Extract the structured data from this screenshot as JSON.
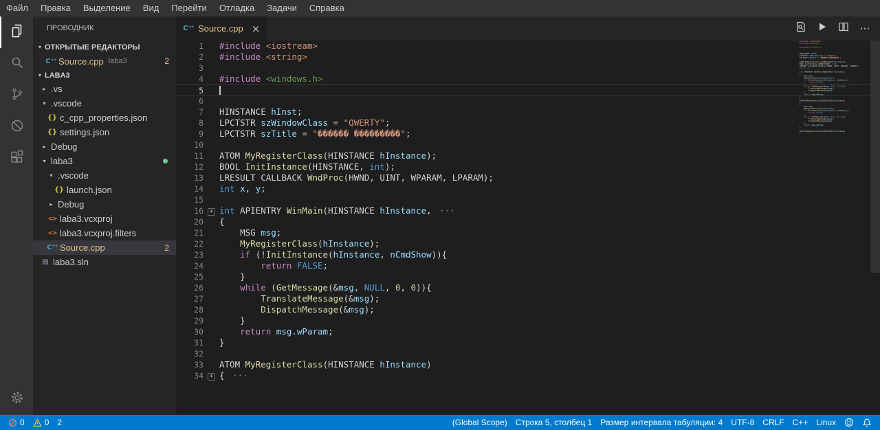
{
  "colors": {
    "accent": "#007acc",
    "modified": "#e2c08d",
    "untracked_dot": "#73c991",
    "token": {
      "pp": "#C586C0",
      "kw": "#569CD6",
      "str": "#CE9178",
      "inc": "#6A9955",
      "fn": "#DCDCAA",
      "var": "#9CDCFE",
      "num": "#B5CEA8",
      "d": "#D4D4D4",
      "typ": "#D4D4D4"
    }
  },
  "menu": {
    "items": [
      {
        "name": "file",
        "label": "Файл"
      },
      {
        "name": "edit",
        "label": "Правка"
      },
      {
        "name": "selection",
        "label": "Выделение"
      },
      {
        "name": "view",
        "label": "Вид"
      },
      {
        "name": "go",
        "label": "Перейти"
      },
      {
        "name": "debug",
        "label": "Отладка"
      },
      {
        "name": "tasks",
        "label": "Задачи"
      },
      {
        "name": "help",
        "label": "Справка"
      }
    ]
  },
  "activity_bar": {
    "items": [
      {
        "name": "explorer",
        "icon": "explorer-icon",
        "active": true
      },
      {
        "name": "search",
        "icon": "search-icon"
      },
      {
        "name": "source-control",
        "icon": "source-control-icon"
      },
      {
        "name": "debug",
        "icon": "debug-icon"
      },
      {
        "name": "extensions",
        "icon": "extensions-icon"
      }
    ],
    "bottom": [
      {
        "name": "settings",
        "icon": "settings-gear-icon"
      }
    ]
  },
  "sidebar": {
    "title": "ПРОВОДНИК",
    "open_editors": {
      "header": "ОТКРЫТЫЕ РЕДАКТОРЫ",
      "items": [
        {
          "label": "Source.cpp",
          "description": "laba3",
          "badge": "2",
          "kind": "cpp",
          "modified": true
        }
      ]
    },
    "tree": {
      "header": "LABA3",
      "items": [
        {
          "label": ".vs",
          "kind": "folder",
          "expanded": false,
          "indent": 0
        },
        {
          "label": ".vscode",
          "kind": "folder",
          "expanded": true,
          "indent": 0
        },
        {
          "label": "c_cpp_properties.json",
          "kind": "json",
          "indent": 1
        },
        {
          "label": "settings.json",
          "kind": "json",
          "indent": 1
        },
        {
          "label": "Debug",
          "kind": "folder",
          "expanded": false,
          "indent": 0
        },
        {
          "label": "laba3",
          "kind": "folder",
          "expanded": true,
          "indent": 0,
          "dot": true
        },
        {
          "label": ".vscode",
          "kind": "folder",
          "expanded": true,
          "indent": 1
        },
        {
          "label": "launch.json",
          "kind": "json",
          "indent": 2
        },
        {
          "label": "Debug",
          "kind": "folder",
          "expanded": false,
          "indent": 1
        },
        {
          "label": "laba3.vcxproj",
          "kind": "xml",
          "indent": 1
        },
        {
          "label": "laba3.vcxproj.filters",
          "kind": "xml",
          "indent": 1
        },
        {
          "label": "Source.cpp",
          "kind": "cpp",
          "indent": 1,
          "badge": "2",
          "selected": true,
          "modified": true
        },
        {
          "label": "laba3.sln",
          "kind": "sln",
          "indent": 0
        }
      ]
    }
  },
  "editor": {
    "tab": {
      "label": "Source.cpp",
      "close_label": "×"
    },
    "fold_ellipsis": "···",
    "actions": [
      {
        "name": "open-changes",
        "icon": "open-changes-icon"
      },
      {
        "name": "run",
        "icon": "run-icon"
      },
      {
        "name": "split-editor",
        "icon": "split-editor-icon"
      },
      {
        "name": "more-actions",
        "icon": "more-actions-icon"
      }
    ],
    "lines": [
      {
        "n": "1",
        "t": [
          [
            "pp",
            "#include"
          ],
          [
            "d",
            " "
          ],
          [
            "str",
            "<iostream>"
          ]
        ]
      },
      {
        "n": "2",
        "t": [
          [
            "pp",
            "#include"
          ],
          [
            "d",
            " "
          ],
          [
            "str",
            "<string>"
          ]
        ]
      },
      {
        "n": "3",
        "t": []
      },
      {
        "n": "4",
        "t": [
          [
            "pp",
            "#include"
          ],
          [
            "d",
            " "
          ],
          [
            "inc",
            "<windows.h>"
          ]
        ]
      },
      {
        "n": "5",
        "t": [],
        "cur": true
      },
      {
        "n": "6",
        "t": []
      },
      {
        "n": "7",
        "t": [
          [
            "typ",
            "HINSTANCE"
          ],
          [
            "d",
            " "
          ],
          [
            "var",
            "hInst"
          ],
          [
            "d",
            ";"
          ]
        ]
      },
      {
        "n": "8",
        "t": [
          [
            "typ",
            "LPCTSTR"
          ],
          [
            "d",
            " "
          ],
          [
            "var",
            "szWindowClass"
          ],
          [
            "d",
            " = "
          ],
          [
            "str",
            "\"QWERTY\""
          ],
          [
            "d",
            ";"
          ]
        ]
      },
      {
        "n": "9",
        "t": [
          [
            "typ",
            "LPCTSTR"
          ],
          [
            "d",
            " "
          ],
          [
            "var",
            "szTitle"
          ],
          [
            "d",
            " = "
          ],
          [
            "str",
            "\"������ ���������\""
          ],
          [
            "d",
            ";"
          ]
        ]
      },
      {
        "n": "10",
        "t": []
      },
      {
        "n": "11",
        "t": [
          [
            "typ",
            "ATOM"
          ],
          [
            "d",
            " "
          ],
          [
            "fn",
            "MyRegisterClass"
          ],
          [
            "d",
            "("
          ],
          [
            "typ",
            "HINSTANCE"
          ],
          [
            "d",
            " "
          ],
          [
            "var",
            "hInstance"
          ],
          [
            "d",
            ");"
          ]
        ]
      },
      {
        "n": "12",
        "t": [
          [
            "typ",
            "BOOL"
          ],
          [
            "d",
            " "
          ],
          [
            "fn",
            "InitInstance"
          ],
          [
            "d",
            "("
          ],
          [
            "typ",
            "HINSTANCE"
          ],
          [
            "d",
            ", "
          ],
          [
            "kw",
            "int"
          ],
          [
            "d",
            ");"
          ]
        ]
      },
      {
        "n": "13",
        "t": [
          [
            "typ",
            "LRESULT"
          ],
          [
            "d",
            " "
          ],
          [
            "typ",
            "CALLBACK"
          ],
          [
            "d",
            " "
          ],
          [
            "fn",
            "WndProc"
          ],
          [
            "d",
            "("
          ],
          [
            "typ",
            "HWND"
          ],
          [
            "d",
            ", "
          ],
          [
            "typ",
            "UINT"
          ],
          [
            "d",
            ", "
          ],
          [
            "typ",
            "WPARAM"
          ],
          [
            "d",
            ", "
          ],
          [
            "typ",
            "LPARAM"
          ],
          [
            "d",
            ");"
          ]
        ]
      },
      {
        "n": "14",
        "t": [
          [
            "kw",
            "int"
          ],
          [
            "d",
            " "
          ],
          [
            "var",
            "x"
          ],
          [
            "d",
            ", "
          ],
          [
            "var",
            "y"
          ],
          [
            "d",
            ";"
          ]
        ]
      },
      {
        "n": "15",
        "t": []
      },
      {
        "n": "16",
        "t": [
          [
            "kw",
            "int"
          ],
          [
            "d",
            " "
          ],
          [
            "typ",
            "APIENTRY"
          ],
          [
            "d",
            " "
          ],
          [
            "fn",
            "WinMain"
          ],
          [
            "d",
            "("
          ],
          [
            "typ",
            "HINSTANCE"
          ],
          [
            "d",
            " "
          ],
          [
            "var",
            "hInstance"
          ],
          [
            "d",
            ", "
          ]
        ],
        "fold": true,
        "ell": true
      },
      {
        "n": "20",
        "t": [
          [
            "d",
            "{"
          ]
        ]
      },
      {
        "n": "21",
        "t": [
          [
            "d",
            "    "
          ],
          [
            "typ",
            "MSG"
          ],
          [
            "d",
            " "
          ],
          [
            "var",
            "msg"
          ],
          [
            "d",
            ";"
          ]
        ]
      },
      {
        "n": "22",
        "t": [
          [
            "d",
            "    "
          ],
          [
            "fn",
            "MyRegisterClass"
          ],
          [
            "d",
            "("
          ],
          [
            "var",
            "hInstance"
          ],
          [
            "d",
            ");"
          ]
        ]
      },
      {
        "n": "23",
        "t": [
          [
            "d",
            "    "
          ],
          [
            "pp",
            "if"
          ],
          [
            "d",
            " (!"
          ],
          [
            "fn",
            "InitInstance"
          ],
          [
            "d",
            "("
          ],
          [
            "var",
            "hInstance"
          ],
          [
            "d",
            ", "
          ],
          [
            "var",
            "nCmdShow"
          ],
          [
            "d",
            ")){"
          ]
        ]
      },
      {
        "n": "24",
        "t": [
          [
            "d",
            "        "
          ],
          [
            "pp",
            "return"
          ],
          [
            "d",
            " "
          ],
          [
            "kw",
            "FALSE"
          ],
          [
            "d",
            ";"
          ]
        ]
      },
      {
        "n": "25",
        "t": [
          [
            "d",
            "    }"
          ]
        ]
      },
      {
        "n": "26",
        "t": [
          [
            "d",
            "    "
          ],
          [
            "pp",
            "while"
          ],
          [
            "d",
            " ("
          ],
          [
            "fn",
            "GetMessage"
          ],
          [
            "d",
            "(&"
          ],
          [
            "var",
            "msg"
          ],
          [
            "d",
            ", "
          ],
          [
            "kw",
            "NULL"
          ],
          [
            "d",
            ", "
          ],
          [
            "num",
            "0"
          ],
          [
            "d",
            ", "
          ],
          [
            "num",
            "0"
          ],
          [
            "d",
            ")){"
          ]
        ]
      },
      {
        "n": "27",
        "t": [
          [
            "d",
            "        "
          ],
          [
            "fn",
            "TranslateMessage"
          ],
          [
            "d",
            "(&"
          ],
          [
            "var",
            "msg"
          ],
          [
            "d",
            ");"
          ]
        ]
      },
      {
        "n": "28",
        "t": [
          [
            "d",
            "        "
          ],
          [
            "fn",
            "DispatchMessage"
          ],
          [
            "d",
            "(&"
          ],
          [
            "var",
            "msg"
          ],
          [
            "d",
            ");"
          ]
        ]
      },
      {
        "n": "29",
        "t": [
          [
            "d",
            "    }"
          ]
        ]
      },
      {
        "n": "30",
        "t": [
          [
            "d",
            "    "
          ],
          [
            "pp",
            "return"
          ],
          [
            "d",
            " "
          ],
          [
            "var",
            "msg"
          ],
          [
            "d",
            "."
          ],
          [
            "var",
            "wParam"
          ],
          [
            "d",
            ";"
          ]
        ]
      },
      {
        "n": "31",
        "t": [
          [
            "d",
            "}"
          ]
        ]
      },
      {
        "n": "32",
        "t": []
      },
      {
        "n": "33",
        "t": [
          [
            "typ",
            "ATOM"
          ],
          [
            "d",
            " "
          ],
          [
            "fn",
            "MyRegisterClass"
          ],
          [
            "d",
            "("
          ],
          [
            "typ",
            "HINSTANCE"
          ],
          [
            "d",
            " "
          ],
          [
            "var",
            "hInstance"
          ],
          [
            "d",
            ")"
          ]
        ]
      },
      {
        "n": "34",
        "t": [
          [
            "d",
            "{ "
          ]
        ],
        "fold": true,
        "ell": true
      }
    ]
  },
  "status_bar": {
    "left": [
      {
        "name": "errors",
        "icon": "error-icon",
        "text": "0",
        "icon_color": "#f48771"
      },
      {
        "name": "warnings",
        "icon": "warning-icon",
        "text": "0",
        "icon_color": "#ffcc66"
      },
      {
        "name": "counter",
        "text": "2"
      }
    ],
    "right": [
      {
        "name": "scope",
        "text": "(Global Scope)"
      },
      {
        "name": "cursor-position",
        "text": "Строка 5, столбец 1"
      },
      {
        "name": "indentation",
        "text": "Размер интервала табуляции: 4"
      },
      {
        "name": "encoding",
        "text": "UTF-8"
      },
      {
        "name": "eol",
        "text": "CRLF"
      },
      {
        "name": "language",
        "text": "C++"
      },
      {
        "name": "os",
        "text": "Linux"
      },
      {
        "name": "feedback",
        "icon": "smiley-icon"
      },
      {
        "name": "notifications",
        "icon": "bell-icon"
      }
    ]
  }
}
